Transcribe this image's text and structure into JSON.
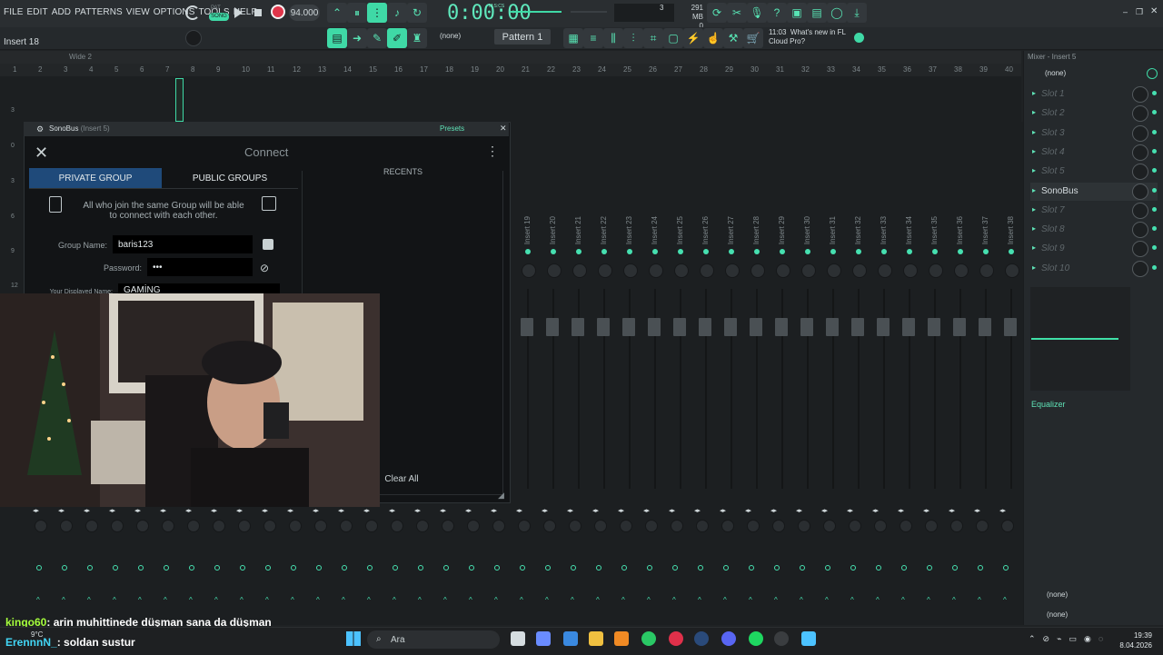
{
  "menu": [
    "FILE",
    "EDIT",
    "ADD",
    "PATTERNS",
    "VIEW",
    "OPTIONS",
    "TOOLS",
    "HELP"
  ],
  "hint": "Insert 18",
  "transport": {
    "mode": "SONG",
    "tempo": "94.000",
    "time": "0:00:00",
    "time_unit": "M:S:CS"
  },
  "memory": {
    "mb": "291 MB",
    "cpu": "3",
    "voices": "0"
  },
  "pattern": "Pattern 1",
  "snap": "(none)",
  "news": {
    "time": "11:03",
    "text1": "What's new in FL",
    "text2": "Cloud Pro?"
  },
  "playlist": {
    "title": "Wide 2",
    "ruler": [
      "1",
      "2",
      "3",
      "4",
      "5",
      "6",
      "7",
      "8",
      "9",
      "10",
      "11",
      "12",
      "13",
      "14",
      "15",
      "16",
      "17",
      "18",
      "19",
      "20",
      "21",
      "22",
      "23",
      "24",
      "25",
      "26",
      "27",
      "28",
      "29",
      "30",
      "31",
      "32",
      "33",
      "34",
      "35",
      "36",
      "37",
      "38",
      "39",
      "40"
    ]
  },
  "plugin": {
    "title": "SonoBus",
    "insert": "(Insert 5)",
    "presets": "Presets",
    "connect_title": "Connect",
    "tab_private": "PRIVATE GROUP",
    "tab_public": "PUBLIC GROUPS",
    "info": "All who join the same Group will be able to connect with each other.",
    "group_name_label": "Group Name:",
    "group_name_value": "baris123",
    "password_label": "Password:",
    "password_value": "•••",
    "display_name_label": "Your Displayed Name:",
    "display_name_value": "GAMİNG",
    "recents": "RECENTS",
    "clear_all": "Clear All"
  },
  "mixer": {
    "strips": [
      "Insert 19",
      "Insert 20",
      "Insert 21",
      "Insert 22",
      "Insert 23",
      "Insert 24",
      "Insert 25",
      "Insert 26",
      "Insert 27",
      "Insert 28",
      "Insert 29",
      "Insert 30",
      "Insert 31",
      "Insert 32",
      "Insert 33",
      "Insert 34",
      "Insert 35",
      "Insert 36",
      "Insert 37",
      "Insert 38"
    ],
    "side_numbers": [
      "3",
      "0",
      "3",
      "6",
      "9",
      "12"
    ]
  },
  "right_panel": {
    "title": "Mixer - Insert 5",
    "top_none": "(none)",
    "slots": [
      "Slot 1",
      "Slot 2",
      "Slot 3",
      "Slot 4",
      "Slot 5",
      "SonoBus",
      "Slot 7",
      "Slot 8",
      "Slot 9",
      "Slot 10"
    ],
    "active_slot": 5,
    "eq_label": "Equalizer",
    "out_none1": "(none)",
    "out_none2": "(none)"
  },
  "chat": {
    "line1_user": "kingo60",
    "line1_text": ": arin muhittinede düşman sana da düşman",
    "line2_user": "ErennnN_",
    "line2_text": ": soldan sustur"
  },
  "taskbar": {
    "weather": "9°C",
    "search": "Ara",
    "time": "19:39",
    "date": "8.04.2026"
  },
  "colors": {
    "accent": "#3fd9a6",
    "bg": "#1f2224",
    "plugin_tab": "#1f4a7a",
    "chat_user1": "#a6ff3c",
    "chat_user2": "#42d6f5"
  }
}
